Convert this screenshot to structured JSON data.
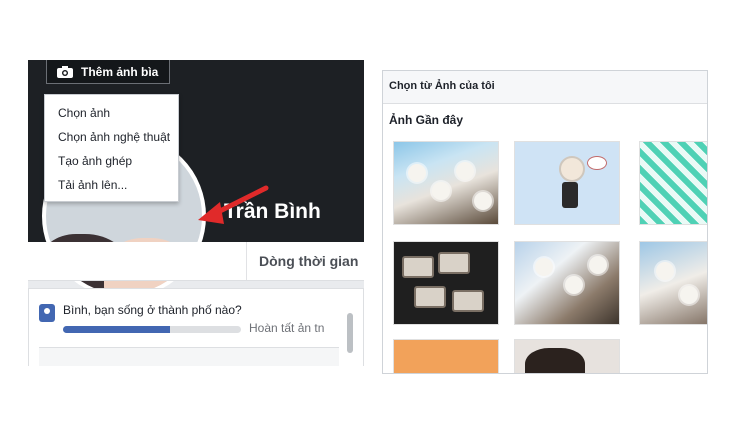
{
  "cover": {
    "button_label": "Thêm ảnh bìa",
    "button_icon": "camera-icon",
    "profile_name": "Trần Bình"
  },
  "cover_menu": {
    "items": [
      {
        "label": "Chọn ảnh"
      },
      {
        "label": "Chọn ảnh nghệ thuật"
      },
      {
        "label": "Tạo ảnh ghép"
      },
      {
        "label": "Tải ảnh lên..."
      }
    ]
  },
  "tabs": {
    "timeline_label": "Dòng thời gian"
  },
  "prompt_card": {
    "question": "Bình, bạn sống ở thành phố nào?",
    "completion_label": "Hoàn tất ản tn",
    "progress_fraction": 0.6
  },
  "picker": {
    "header": "Chọn từ Ảnh của tôi",
    "section_title": "Ảnh Gần đây",
    "photos": [
      {
        "subject": "cherry-blossoms"
      },
      {
        "subject": "chibi-cartoon"
      },
      {
        "subject": "teal-pattern"
      },
      {
        "subject": "cassette-tapes"
      },
      {
        "subject": "cherry-blossoms"
      },
      {
        "subject": "cherry-blossoms"
      },
      {
        "subject": "orange-figures"
      },
      {
        "subject": "portrait"
      }
    ]
  },
  "colors": {
    "cover_dark": "#1d2024",
    "accent_blue": "#4267b2",
    "annotation_arrow": "#e02a2a"
  }
}
